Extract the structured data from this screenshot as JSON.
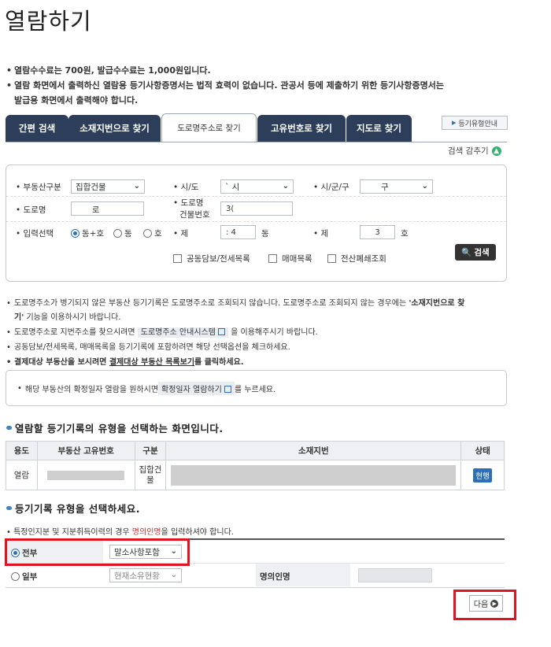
{
  "page_title": "열람하기",
  "notices": [
    "열람수수료는 700원, 발급수수료는 1,000원입니다.",
    "열람 화면에서 출력하신 열람용 등기사항증명서는 법적 효력이 없습니다. 관공서 등에 제출하기 위한 등기사항증명서는",
    "발급용 화면에서 출력해야 합니다."
  ],
  "tabs": [
    {
      "label": "간편 검색"
    },
    {
      "label": "소재지번으로 찾기"
    },
    {
      "label": "도로명주소로 찾기",
      "active": true
    },
    {
      "label": "고유번호로 찾기"
    },
    {
      "label": "지도로 찾기"
    }
  ],
  "guide_button": "등기유형안내",
  "collapse_label": "검색 감추기",
  "form": {
    "property_type_label": "부동산구분",
    "property_type_value": "집합건물",
    "sido_label": "시/도",
    "sido_value": "`          시",
    "sigungu_label": "시/군/구",
    "sigungu_value": "구",
    "road_label": "도로명",
    "road_value": "로",
    "building_no_label_1": "도로명",
    "building_no_label_2": "건물번호",
    "building_no_value": "3(",
    "input_select_label": "입력선택",
    "radio_options": [
      "동+호",
      "동",
      "호"
    ],
    "radio_selected": "동+호",
    "dong_label": "제",
    "dong_value": ":    4",
    "dong_unit": "동",
    "ho_label": "제",
    "ho_value": "3",
    "ho_unit": "호",
    "checkboxes": [
      "공동담보/전세목록",
      "매매목록",
      "전산폐쇄조회"
    ],
    "search_button": "검색"
  },
  "info_lines": {
    "line1a": "도로명주소가 병기되지 않은 부동산 등기기록은 도로명주소로 조회되지 않습니다. 도로명주소로 조회되지 않는 경우에는 ",
    "line1b": "'소재지번으로 찾",
    "line1c": "기'",
    "line1d": " 기능을 이용하시기 바랍니다.",
    "line2a": "도로명주소로 지번주소를 찾으시려면 ",
    "line2link": "도로명주소 안내시스템",
    "line2b": " 을 이용해주시기 바랍니다.",
    "line3": "공동담보/전세목록, 매매목록을 등기기록에 포함하려면 해당 선택옵션을 체크하세요.",
    "line4a": "결제대상 부동산을 보시려면 ",
    "line4link": "결제대상 부동산 목록보기",
    "line4b": "를 클릭하세요."
  },
  "confirm_box": {
    "text_a": "해당 부동산의 확정일자 열람을 원하시면 ",
    "button": "확정일자 열람하기",
    "text_b": " 를 누르세요."
  },
  "section1_title": "열람할 등기기록의 유형을 선택하는 화면입니다.",
  "result_table": {
    "headers": [
      "용도",
      "부동산 고유번호",
      "구분",
      "소재지번",
      "상태"
    ],
    "row": {
      "use": "열람",
      "type": "집합건물",
      "state": "현행"
    }
  },
  "section2_title": "등기기록 유형을 선택하세요.",
  "warning": {
    "text_a": "특정인지분 및 지분취득이력의 경우 ",
    "text_red": "명의인명",
    "text_b": "을 입력하셔야 합니다."
  },
  "record_select": {
    "full_label": "전부",
    "full_option": "말소사항포함",
    "partial_label": "일부",
    "partial_option": "현재소유현황",
    "name_label": "명의인명"
  },
  "next_button": "다음",
  "colors": {
    "tab_bg": "#2c3e5a",
    "accent_blue": "#2c6fb6",
    "highlight_red": "#e0141e",
    "green": "#34b36e"
  }
}
